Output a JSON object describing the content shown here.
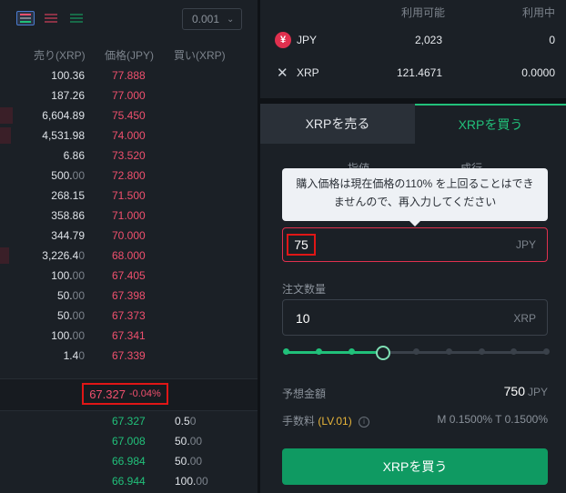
{
  "orderbook": {
    "precision": "0.001",
    "headers": {
      "sell": "売り(XRP)",
      "price": "価格(JPY)",
      "buy": "買い(XRP)"
    },
    "asks": [
      {
        "amount": "100.36",
        "dim": "",
        "price": "77.888"
      },
      {
        "amount": "187.26",
        "dim": "",
        "price": "77.000"
      },
      {
        "amount": "6,604.89",
        "dim": "",
        "price": "75.450"
      },
      {
        "amount": "4,531.98",
        "dim": "",
        "price": "74.000"
      },
      {
        "amount": "6.86",
        "dim": "",
        "price": "73.520"
      },
      {
        "amount": "500.",
        "dim": "00",
        "price": "72.800"
      },
      {
        "amount": "268.15",
        "dim": "",
        "price": "71.500"
      },
      {
        "amount": "358.86",
        "dim": "",
        "price": "71.000"
      },
      {
        "amount": "344.79",
        "dim": "",
        "price": "70.000"
      },
      {
        "amount": "3,226.4",
        "dim": "0",
        "price": "68.000"
      },
      {
        "amount": "100.",
        "dim": "00",
        "price": "67.405"
      },
      {
        "amount": "50.",
        "dim": "00",
        "price": "67.398"
      },
      {
        "amount": "50.",
        "dim": "00",
        "price": "67.373"
      },
      {
        "amount": "100.",
        "dim": "00",
        "price": "67.341"
      },
      {
        "amount": "1.4",
        "dim": "0",
        "price": "67.339"
      }
    ],
    "last_price": "67.327",
    "change": "-0.04%",
    "bids": [
      {
        "price": "67.327",
        "amount": "0.5",
        "dim": "0"
      },
      {
        "price": "67.008",
        "amount": "50.",
        "dim": "00"
      },
      {
        "price": "66.984",
        "amount": "50.",
        "dim": "00"
      },
      {
        "price": "66.944",
        "amount": "100.",
        "dim": "00"
      }
    ]
  },
  "balances": {
    "header_available": "利用可能",
    "header_in_use": "利用中",
    "rows": [
      {
        "name": "JPY",
        "icon": "yen-icon",
        "available": "2,023",
        "in_use": "0"
      },
      {
        "name": "XRP",
        "icon": "xrp-icon",
        "available": "121.4671",
        "in_use": "0.0000"
      }
    ]
  },
  "trade": {
    "tab_sell": "XRPを売る",
    "tab_buy": "XRPを買う",
    "type_limit": "指値",
    "type_market": "成行",
    "tooltip": "購入価格は現在価格の110% を上回ることはできませんので、再入力してください",
    "price_value": "75",
    "price_unit": "JPY",
    "qty_label": "注文数量",
    "qty_value": "10",
    "qty_unit": "XRP",
    "slider_level": 0.36,
    "est_label": "予想金額",
    "est_value": "750",
    "est_unit": "JPY",
    "fee_label": "手数料",
    "fee_level": "(LV.01)",
    "fee_value": "M 0.1500% T 0.1500%",
    "buy_button": "XRPを買う"
  },
  "colors": {
    "ask": "#f0506e",
    "bid": "#21c07a",
    "alert": "#e01616"
  }
}
